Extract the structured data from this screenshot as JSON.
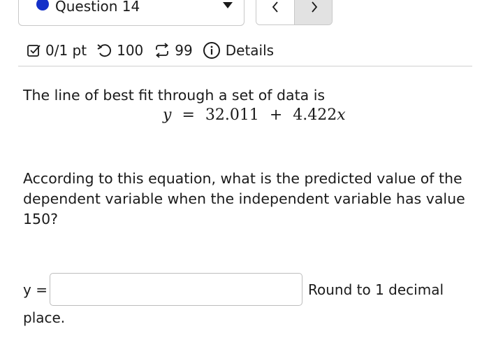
{
  "question_selector": {
    "label": "Question 14",
    "status_color": "#1430c8"
  },
  "nav": {
    "prev_icon": "chevron-left-icon",
    "next_icon": "chevron-right-icon"
  },
  "meta": {
    "score": "0/1 pt",
    "retries": "100",
    "submissions": "99",
    "details_label": "Details"
  },
  "problem": {
    "intro": "The line of best fit through a set of data is",
    "equation": {
      "lhs": "y",
      "equals": "=",
      "intercept": "32.011",
      "plus": "+",
      "slope": "4.422",
      "variable": "x"
    },
    "question": "According to this equation, what is the predicted value of the dependent variable when the independent variable has value 150?"
  },
  "answer": {
    "label": "y =",
    "value": "",
    "instruction_a": "Round to 1 decimal",
    "instruction_b": "place."
  }
}
